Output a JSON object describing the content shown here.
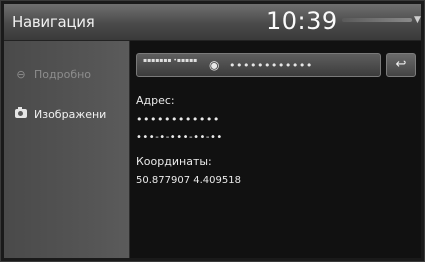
{
  "header": {
    "title": "Навигация",
    "clock": "10:39"
  },
  "sidebar": {
    "items": [
      {
        "label": "Подробно",
        "icon": "info-icon",
        "state": "disabled"
      },
      {
        "label": "Изображени",
        "icon": "camera-icon",
        "state": "active"
      }
    ]
  },
  "location_bar": {
    "small_text": "▪▪▪▪▪▪▪ •▪▪▪▪▪",
    "name": "••••••••••••",
    "back_label": "↩"
  },
  "details": {
    "address_label": "Адрес:",
    "address_line1": "••••••••••••",
    "address_line2": "•••-•-•••-••-••",
    "coordinates_label": "Координаты:",
    "coordinates_value": "50.877907 4.409518"
  },
  "colors": {
    "background": "#111111",
    "panel": "#4f4f4f",
    "text": "#eaeaea"
  }
}
